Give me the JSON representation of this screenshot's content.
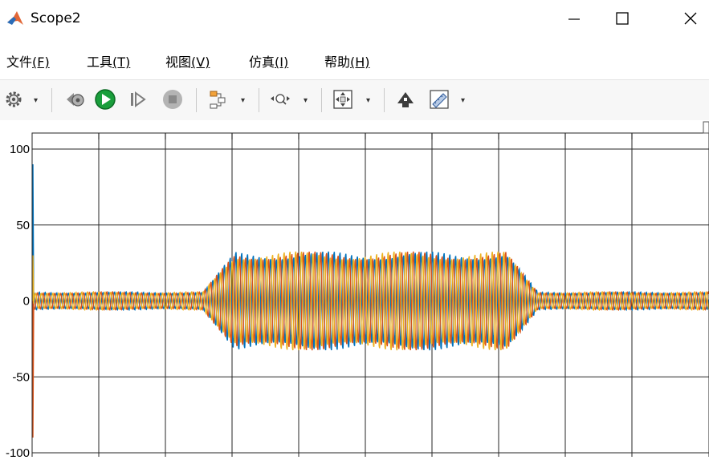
{
  "window": {
    "title": "Scope2"
  },
  "menu": [
    {
      "label": "文件",
      "accel": "(F)"
    },
    {
      "label": "工具",
      "accel": "(T)"
    },
    {
      "label": "视图",
      "accel": "(V)"
    },
    {
      "label": "仿真",
      "accel": "(I)"
    },
    {
      "label": "帮助",
      "accel": "(H)"
    }
  ],
  "toolbar": {
    "icons": [
      "gear-icon",
      "step-back-icon",
      "run-icon",
      "step-forward-icon",
      "stop-icon",
      "signal-select-icon",
      "zoom-icon",
      "autoscale-icon",
      "highlight-block-icon",
      "measurements-icon"
    ]
  },
  "colors": {
    "series": [
      "#0072BD",
      "#D95319",
      "#EDB120",
      "#7E2F8E"
    ],
    "grid": "#262626"
  },
  "chart_data": {
    "type": "line",
    "title": "",
    "xlabel": "",
    "ylabel": "",
    "ylim": [
      -100,
      100
    ],
    "yticks": [
      "100",
      "50",
      "0",
      "-50",
      "-100"
    ],
    "grid": true,
    "legend": "none",
    "series": [
      {
        "color": "#0072BD",
        "phase": 0.0,
        "start_spike": 90
      },
      {
        "color": "#D95319",
        "phase": 2.094,
        "start_spike": -90
      },
      {
        "color": "#EDB120",
        "phase": 4.189,
        "start_spike": 30
      }
    ],
    "envelope": {
      "baseline_amplitude": 6,
      "burst_amplitude": 33,
      "burst_start_fraction": 0.3,
      "burst_end_fraction": 0.7
    }
  }
}
